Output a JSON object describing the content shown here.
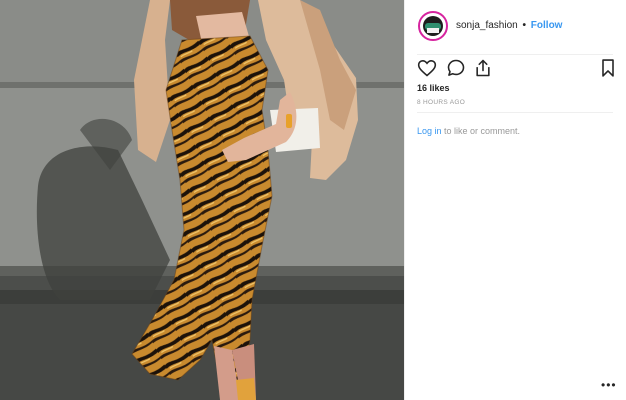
{
  "post": {
    "username": "sonja_fashion",
    "separator": "•",
    "follow_label": "Follow",
    "likes_text": "16 likes",
    "timestamp": "8 HOURS AGO",
    "login_label": "Log in",
    "comment_suffix": " to like or comment.",
    "more_label": "•••"
  },
  "colors": {
    "link": "#3897f0",
    "text": "#262626",
    "muted": "#999999"
  },
  "icons": [
    "heart-icon",
    "comment-icon",
    "share-icon",
    "bookmark-icon",
    "more-options-icon"
  ]
}
